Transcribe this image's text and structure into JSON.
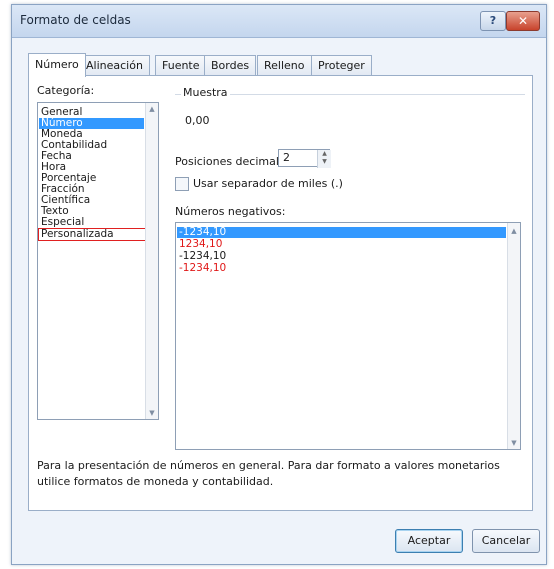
{
  "window": {
    "title": "Formato de celdas",
    "help_label": "?",
    "close_label": "✕"
  },
  "tabs": [
    "Número",
    "Alineación",
    "Fuente",
    "Bordes",
    "Relleno",
    "Proteger"
  ],
  "active_tab": "Número",
  "category": {
    "label": "Categoría:",
    "items": [
      "General",
      "Número",
      "Moneda",
      "Contabilidad",
      "Fecha",
      "Hora",
      "Porcentaje",
      "Fracción",
      "Científica",
      "Texto",
      "Especial",
      "Personalizada"
    ],
    "selected": "Número",
    "highlighted": "Personalizada"
  },
  "sample": {
    "label": "Muestra",
    "value": "0,00"
  },
  "decimal_places": {
    "label": "Posiciones decimales:",
    "value": "2"
  },
  "thousands_separator": {
    "label": "Usar separador de miles (.)",
    "checked": false
  },
  "negative_numbers": {
    "label": "Números negativos:",
    "items": [
      "-1234,10",
      "1234,10",
      "-1234,10",
      "-1234,10"
    ],
    "selected_index": 0,
    "red_items": [
      1,
      3
    ]
  },
  "description": "Para la presentación de números en general. Para dar formato a valores monetarios utilice formatos de moneda y contabilidad.",
  "buttons": {
    "ok": "Aceptar",
    "cancel": "Cancelar"
  },
  "colors": {
    "selection": "#3399ff",
    "negative_red": "#e01818",
    "highlight_border": "#e02020"
  }
}
